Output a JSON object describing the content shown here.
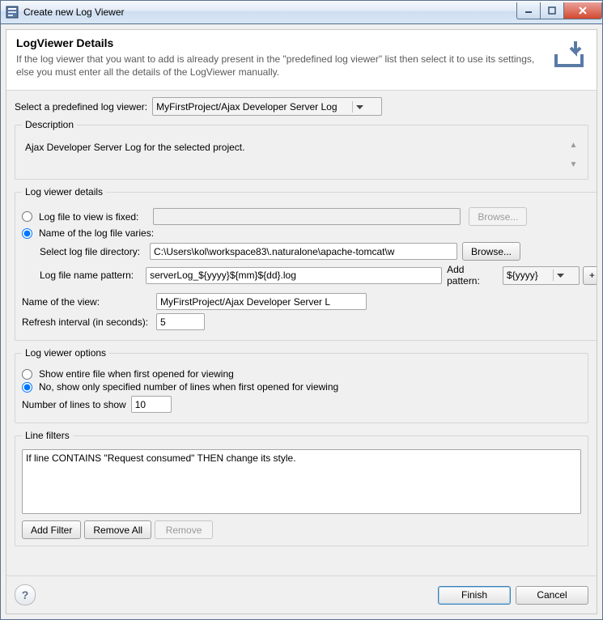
{
  "window": {
    "title": "Create new Log Viewer"
  },
  "banner": {
    "heading": "LogViewer Details",
    "text": "If the log viewer that you want to add is already present in the \"predefined log viewer\" list then select it to use its settings, else you must enter all the details of the LogViewer manually."
  },
  "predef": {
    "label": "Select a predefined log viewer:",
    "value": "MyFirstProject/Ajax Developer Server Log"
  },
  "description": {
    "group": "Description",
    "text": "Ajax Developer Server Log for the selected project."
  },
  "details": {
    "group": "Log viewer details",
    "fixed_label": "Log file to view is fixed:",
    "browse": "Browse...",
    "varies_label": "Name of the log file varies:",
    "dir_label": "Select log file directory:",
    "dir_value": "C:\\Users\\kol\\workspace83\\.naturalone\\apache-tomcat\\w",
    "pattern_label": "Log file name pattern:",
    "pattern_value": "serverLog_${yyyy}${mm}${dd}.log",
    "add_pattern_label": "Add pattern:",
    "add_pattern_value": "${yyyy}",
    "add_pattern_btn": "+",
    "viewname_label": "Name of the view:",
    "viewname_value": "MyFirstProject/Ajax Developer Server L",
    "refresh_label": "Refresh interval (in seconds):",
    "refresh_value": "5"
  },
  "options": {
    "group": "Log viewer options",
    "entire_label": "Show entire file when first opened for viewing",
    "partial_label": "No, show only specified number of lines when first opened for viewing",
    "numlines_label": "Number of lines to show",
    "numlines_value": "10"
  },
  "filters": {
    "group": "Line filters",
    "item0": "If line CONTAINS \"Request consumed\" THEN change its style.",
    "add": "Add Filter",
    "remove_all": "Remove All",
    "remove": "Remove"
  },
  "footer": {
    "finish": "Finish",
    "cancel": "Cancel"
  }
}
